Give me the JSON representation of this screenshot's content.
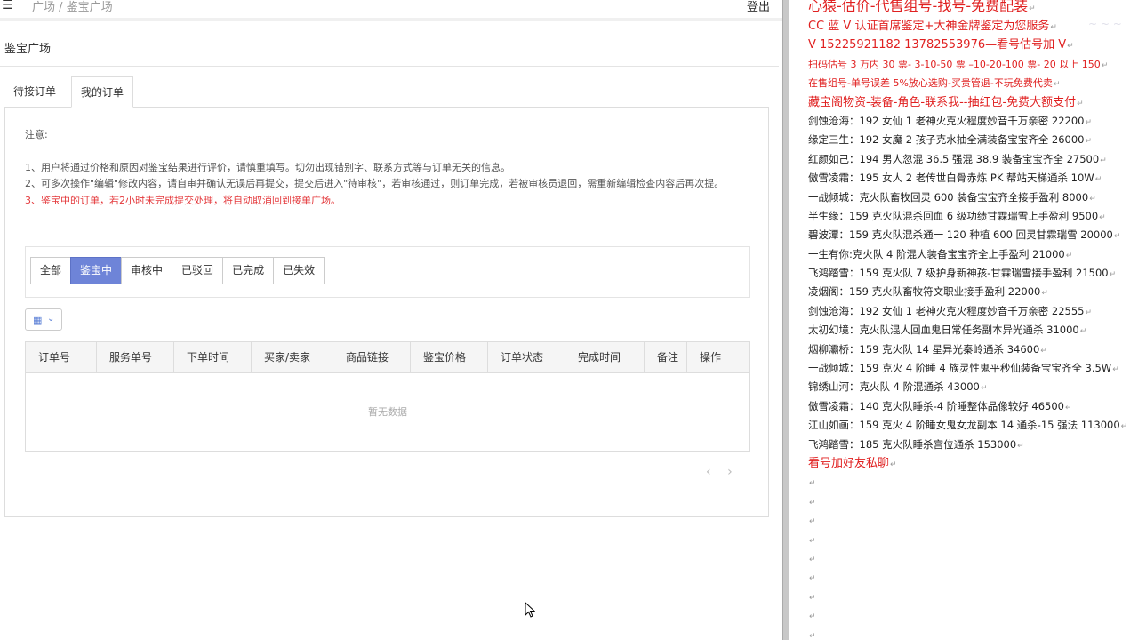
{
  "topbar": {
    "menu_icon": "menu-icon",
    "breadcrumb": "广场 / 鉴宝广场",
    "logout": "登出"
  },
  "page_title": "鉴宝广场",
  "tabs": [
    {
      "label": "待接订单"
    },
    {
      "label": "我的订单"
    }
  ],
  "notes": {
    "heading": "注意:",
    "items": [
      "1、用户将通过价格和原因对鉴宝结果进行评价，请慎重填写。切勿出现错别字、联系方式等与订单无关的信息。",
      "2、可多次操作\"编辑\"修改内容，请自审并确认无误后再提交，提交后进入\"待审核\"，若审核通过，则订单完成，若被审核员退回，需重新编辑检查内容后再次提。",
      "3、鉴宝中的订单，若2小时未完成提交处理，将自动取消回到接单广场。"
    ]
  },
  "filters": [
    {
      "label": "全部"
    },
    {
      "label": "鉴宝中"
    },
    {
      "label": "审核中"
    },
    {
      "label": "已驳回"
    },
    {
      "label": "已完成"
    },
    {
      "label": "已失效"
    }
  ],
  "table": {
    "headers": [
      "订单号",
      "服务单号",
      "下单时间",
      "买家/卖家",
      "商品链接",
      "鉴宝价格",
      "订单状态",
      "完成时间",
      "备注",
      "操作"
    ],
    "empty_text": "暂无数据"
  },
  "pager": {
    "prev": "‹",
    "next": "›"
  },
  "doc": {
    "lines": [
      "心猿-估价-代售组号-找号-免费配装",
      "CC 蓝 V 认证首席鉴定+大神金牌鉴定为您服务",
      "V 15225921182      13782553976—看号估号加 V",
      "扫码估号 3 万内 30 票- 3-10-50 票  –10-20-100 票- 20 以上 150",
      "在售组号-单号误差 5%放心选购-买贵管退-不玩免费代卖",
      "藏宝阁物资-装备-角色-联系我--抽红包-免费大额支付",
      "剑蚀沧海：192 女仙 1 老神火克火程度妙音千万亲密 22200",
      "缘定三生：192 女魔 2 孩子克水抽全满装备宝宝齐全 26000",
      "红颜如己：194 男人忽混 36.5 强混 38.9 装备宝宝齐全 27500",
      "傲雪凌霜：195 女人 2 老传世白骨赤炼 PK 帮站天梯通杀 10W",
      "一战倾城：克火队畜牧回灵 600 装备宝宝齐全接手盈利 8000",
      "半生缘：159 克火队混杀回血 6 级功绩甘霖瑞雪上手盈利 9500",
      "碧波潭：159 克火队混杀通一 120 种植 600 回灵甘霖瑞雪 20000",
      "一生有你:克火队 4 阶混人装备宝宝齐全上手盈利 21000",
      "飞鸿踏雪：159 克火队 7 级护身新神孩-甘霖瑞雪接手盈利 21500",
      "凌烟阁：159 克火队畜牧符文职业接手盈利 22000",
      "剑蚀沧海：192 女仙 1 老神火克火程度妙音千万亲密 22555",
      "太初幻境：克火队混人回血鬼日常任务副本异光通杀 31000",
      "烟柳灞桥：159 克火队 14 星异光秦岭通杀 34600",
      "一战倾城：159 克火 4 阶睡 4 族灵性鬼平秒仙装备宝宝齐全 3.5W",
      "锦绣山河：克火队 4 阶混通杀 43000",
      "傲雪凌霜：140 克火队睡杀-4 阶睡整体品像较好 46500",
      "江山如画：159 克火 4 阶睡女鬼女龙副本 14 通杀-15 强法 113000",
      "飞鸿踏雪：185 克火队睡杀宫位通杀 153000",
      "看号加好友私聊"
    ],
    "pilcrow": "↵"
  },
  "colors": {
    "accent": "#6e84d8",
    "red_text": "#e02020",
    "notice_red": "#e4393c"
  }
}
